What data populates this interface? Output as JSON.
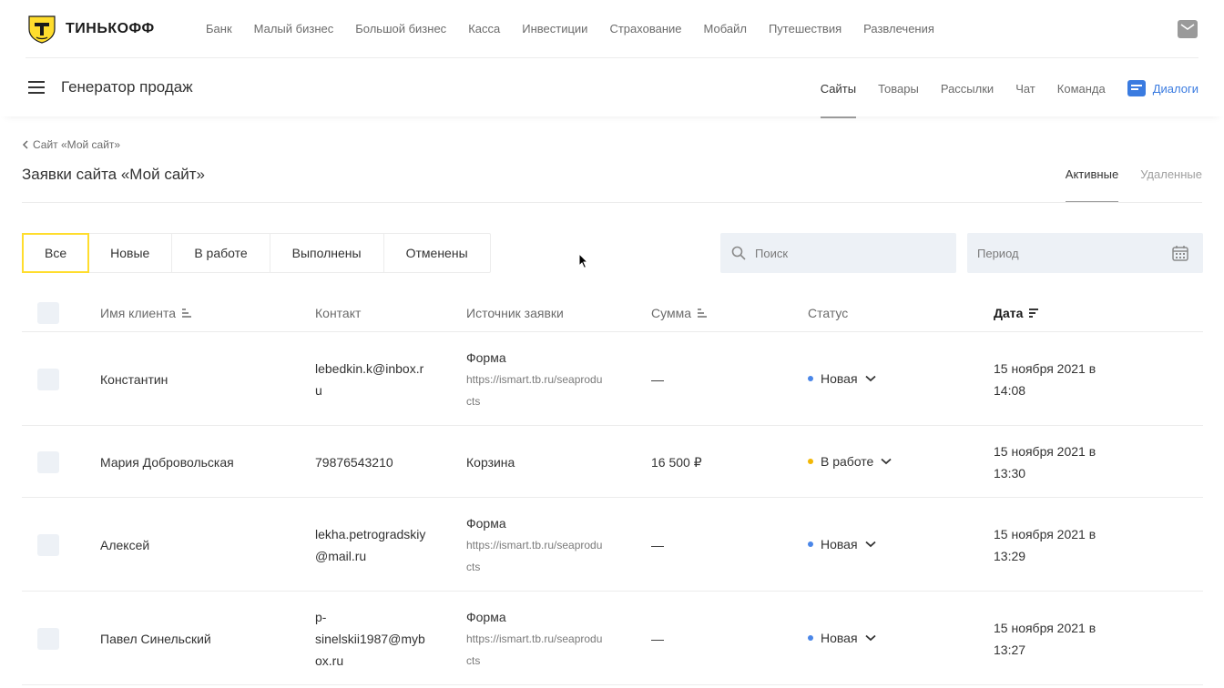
{
  "brand": {
    "name": "ТИНЬКОФФ"
  },
  "top_nav": [
    "Банк",
    "Малый бизнес",
    "Большой бизнес",
    "Касса",
    "Инвестиции",
    "Страхование",
    "Мобайл",
    "Путешествия",
    "Развлечения"
  ],
  "product": {
    "title": "Генератор продаж",
    "nav": [
      "Сайты",
      "Товары",
      "Рассылки",
      "Чат",
      "Команда"
    ],
    "active_nav": "Сайты",
    "dialogs_label": "Диалоги"
  },
  "breadcrumb": {
    "back_label": "Сайт «Мой сайт»"
  },
  "page": {
    "title": "Заявки сайта «Мой сайт»",
    "tabs": [
      "Активные",
      "Удаленные"
    ],
    "active_tab": "Активные"
  },
  "filters": {
    "segments": [
      "Все",
      "Новые",
      "В работе",
      "Выполнены",
      "Отменены"
    ],
    "active": "Все",
    "search_placeholder": "Поиск",
    "period_placeholder": "Период"
  },
  "table": {
    "columns": {
      "name": "Имя клиента",
      "contact": "Контакт",
      "source": "Источник заявки",
      "amount": "Сумма",
      "status": "Статус",
      "date": "Дата"
    },
    "rows": [
      {
        "name": "Константин",
        "contact": [
          "lebedkin.k@inbox.r",
          "u"
        ],
        "source_title": "Форма",
        "source_url": [
          "https://ismart.tb.ru/seaprodu",
          "cts"
        ],
        "amount": "—",
        "status": "Новая",
        "date": [
          "15 ноября 2021 в",
          "14:08"
        ]
      },
      {
        "name": "Мария Добровольская",
        "contact": [
          "79876543210"
        ],
        "source_title": "Корзина",
        "source_url": [],
        "amount": "16 500 ₽",
        "status": "В работе",
        "date": [
          "15 ноября 2021 в",
          "13:30"
        ]
      },
      {
        "name": "Алексей",
        "contact": [
          "lekha.petrogradskiy",
          "@mail.ru"
        ],
        "source_title": "Форма",
        "source_url": [
          "https://ismart.tb.ru/seaprodu",
          "cts"
        ],
        "amount": "—",
        "status": "Новая",
        "date": [
          "15 ноября 2021 в",
          "13:29"
        ]
      },
      {
        "name": "Павел Синельский",
        "contact": [
          "p-",
          "sinelskii1987@myb",
          "ox.ru"
        ],
        "source_title": "Форма",
        "source_url": [
          "https://ismart.tb.ru/seaprodu",
          "cts"
        ],
        "amount": "—",
        "status": "Новая",
        "date": [
          "15 ноября 2021 в",
          "13:27"
        ]
      }
    ]
  },
  "colors": {
    "accent_yellow": "#ffdd2d",
    "link_blue": "#3a7be0",
    "status_new": "#4a86e8",
    "status_in_work": "#f2b705",
    "input_bg": "#edf1f6"
  },
  "icons": {
    "logo": "tinkoff-emblem-icon",
    "mail": "mail-icon",
    "menu": "burger-menu-icon",
    "dialogs": "chat-bubble-icon",
    "back": "chevron-left-icon",
    "search": "search-icon",
    "calendar": "calendar-icon",
    "sort": "sort-icon",
    "status_dropdown": "chevron-down-icon"
  }
}
